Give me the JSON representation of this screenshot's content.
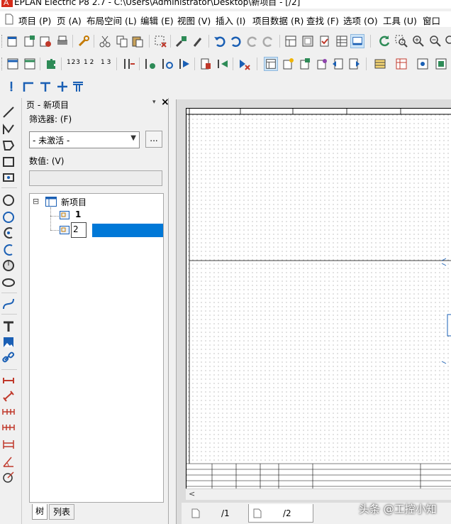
{
  "window": {
    "title": "EPLAN Electric P8 2.7 - C:\\Users\\Administrator\\Desktop\\新项目 - [/2]"
  },
  "menu": [
    {
      "label": "项目 (P)"
    },
    {
      "label": "页 (A)"
    },
    {
      "label": "布局空间 (L)"
    },
    {
      "label": "编辑 (E)"
    },
    {
      "label": "视图 (V)"
    },
    {
      "label": "插入 (I)"
    },
    {
      "label": "项目数据 (R)"
    },
    {
      "label": "查找 (F)"
    },
    {
      "label": "选项 (O)"
    },
    {
      "label": "工具 (U)"
    },
    {
      "label": "窗口"
    }
  ],
  "toolbar_row2_labels": {
    "num1": "1 2 3",
    "num2": "1 2",
    "num3": "1 3"
  },
  "panel": {
    "title": "页 - 新项目",
    "filter_label": "筛选器: (F)",
    "filter_value": "- 未激活 -",
    "ellipsis": "...",
    "value_label": "数值: (V)",
    "value_text": ""
  },
  "tree": {
    "expander": "⊟",
    "root": "新项目",
    "pages": [
      {
        "label": "1"
      },
      {
        "label": "2",
        "editing": true
      }
    ]
  },
  "panel_tabs": [
    {
      "label": "树",
      "active": true
    },
    {
      "label": "列表",
      "active": false
    }
  ],
  "page_tabs": [
    {
      "label": "/1",
      "active": false
    },
    {
      "label": "/2",
      "active": true
    }
  ],
  "watermark": "头条 @工控小知",
  "colors": {
    "selection": "#0078d7",
    "background": "#f0f0f0",
    "accent_blue": "#1a5fb4",
    "accent_green": "#2e8b57",
    "accent_red": "#c0392b"
  }
}
